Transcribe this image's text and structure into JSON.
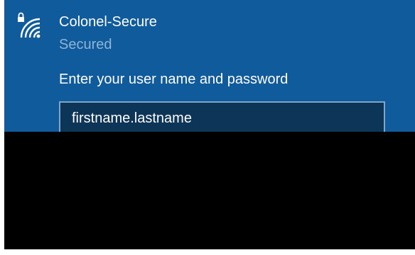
{
  "network": {
    "name": "Colonel-Secure",
    "status": "Secured",
    "icon": "wifi-secured-icon"
  },
  "login": {
    "prompt": "Enter your user name and password",
    "username_value": "firstname.lastname"
  },
  "colors": {
    "panel": "#0f5b9b",
    "status_text": "#8fb4d6",
    "field_background": "#0d3558",
    "field_border": "#7fa6c9",
    "redaction": "#000000"
  }
}
